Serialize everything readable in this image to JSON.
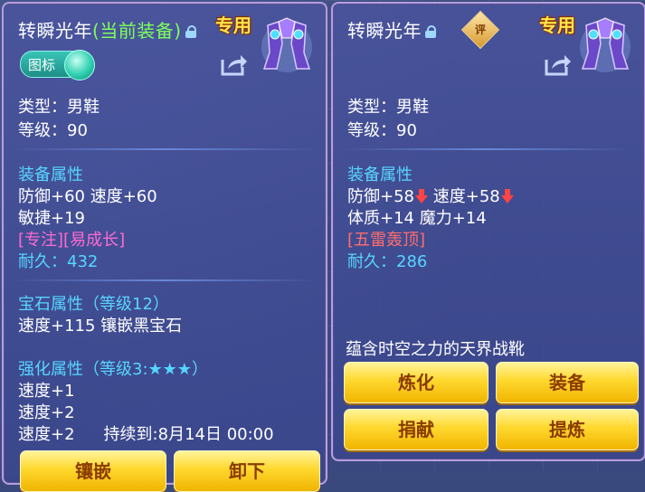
{
  "left": {
    "title": "转瞬光年",
    "equipped_tag": "(当前装备)",
    "exclusive": "专用",
    "toggle_label": "图标",
    "type": "类型：男鞋",
    "level": "等级：90",
    "attr_header": "装备属性",
    "attr1": "防御+60 速度+60",
    "attr2": "敏捷+19",
    "special": "[专注][易成长]",
    "durability": "耐久：432",
    "gem_header": "宝石属性（等级12）",
    "gem_line": "速度+115 镶嵌黑宝石",
    "enh_header": "强化属性（等级3:★★★）",
    "enh1": "速度+1",
    "enh2": "速度+2",
    "enh3": "速度+2",
    "enh3_duration": "持续到:8月14日 00:00",
    "btn_inlay": "镶嵌",
    "btn_unequip": "卸下"
  },
  "right": {
    "title": "转瞬光年",
    "rating_badge": "评",
    "exclusive": "专用",
    "type": "类型：男鞋",
    "level": "等级：90",
    "attr_header": "装备属性",
    "defense": "防御+58",
    "speed": "速度+58",
    "attr2": "体质+14 魔力+14",
    "special": "[五雷轰顶]",
    "durability": "耐久：286",
    "description": "蕴含时空之力的天界战靴",
    "btn_refine": "炼化",
    "btn_equip": "装备",
    "btn_donate": "捐献",
    "btn_extract": "提炼"
  },
  "colors": {
    "panel": "#4a549e",
    "cyan": "#56d6ff",
    "gold": "#ffe84a",
    "pink": "#ff6ad2",
    "red_text": "#ff6d6d",
    "button": "#ffd82e"
  },
  "icons": [
    "lock-icon",
    "share-icon",
    "boots-icon",
    "rating-badge-icon",
    "down-arrow-icon"
  ]
}
